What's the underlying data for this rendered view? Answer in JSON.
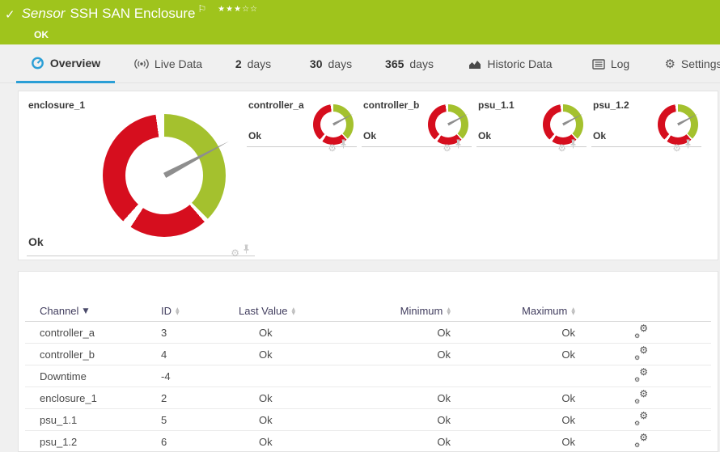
{
  "header": {
    "check_icon": "✓",
    "type_label": "Sensor",
    "title": "SSH SAN Enclosure",
    "flag_icon": "⚐",
    "stars_filled": "★★★",
    "stars_empty": "☆☆",
    "status": "OK"
  },
  "tabs": [
    {
      "label": "Overview",
      "active": true
    },
    {
      "label": "Live Data"
    },
    {
      "prefix": "2",
      "label": "days"
    },
    {
      "prefix": "30",
      "label": "days"
    },
    {
      "prefix": "365",
      "label": "days"
    },
    {
      "label": "Historic Data"
    },
    {
      "label": "Log"
    },
    {
      "label": "Settings"
    }
  ],
  "gauges": {
    "primary": {
      "name": "enclosure_1",
      "status": "Ok"
    },
    "secondary": [
      {
        "name": "controller_a",
        "status": "Ok"
      },
      {
        "name": "controller_b",
        "status": "Ok"
      },
      {
        "name": "psu_1.1",
        "status": "Ok"
      },
      {
        "name": "psu_1.2",
        "status": "Ok"
      }
    ]
  },
  "channel_table": {
    "headers": {
      "channel": "Channel",
      "id": "ID",
      "last_value": "Last Value",
      "minimum": "Minimum",
      "maximum": "Maximum"
    },
    "sorted_by": "Channel",
    "rows": [
      {
        "channel": "controller_a",
        "id": "3",
        "last": "Ok",
        "min": "Ok",
        "max": "Ok"
      },
      {
        "channel": "controller_b",
        "id": "4",
        "last": "Ok",
        "min": "Ok",
        "max": "Ok"
      },
      {
        "channel": "Downtime",
        "id": "-4",
        "last": "",
        "min": "",
        "max": ""
      },
      {
        "channel": "enclosure_1",
        "id": "2",
        "last": "Ok",
        "min": "Ok",
        "max": "Ok"
      },
      {
        "channel": "psu_1.1",
        "id": "5",
        "last": "Ok",
        "min": "Ok",
        "max": "Ok"
      },
      {
        "channel": "psu_1.2",
        "id": "6",
        "last": "Ok",
        "min": "Ok",
        "max": "Ok"
      }
    ]
  },
  "icons": {
    "gear": "⚙",
    "sort_desc": "▼",
    "sort_up": "▲",
    "sort_down": "▼"
  },
  "colors": {
    "header_green": "#9fc41c",
    "gauge_green": "#a4c12e",
    "gauge_red": "#d60e1e",
    "needle_gray": "#8e8e8e",
    "accent_blue": "#2b9fd6",
    "table_header_text": "#413d5e"
  }
}
